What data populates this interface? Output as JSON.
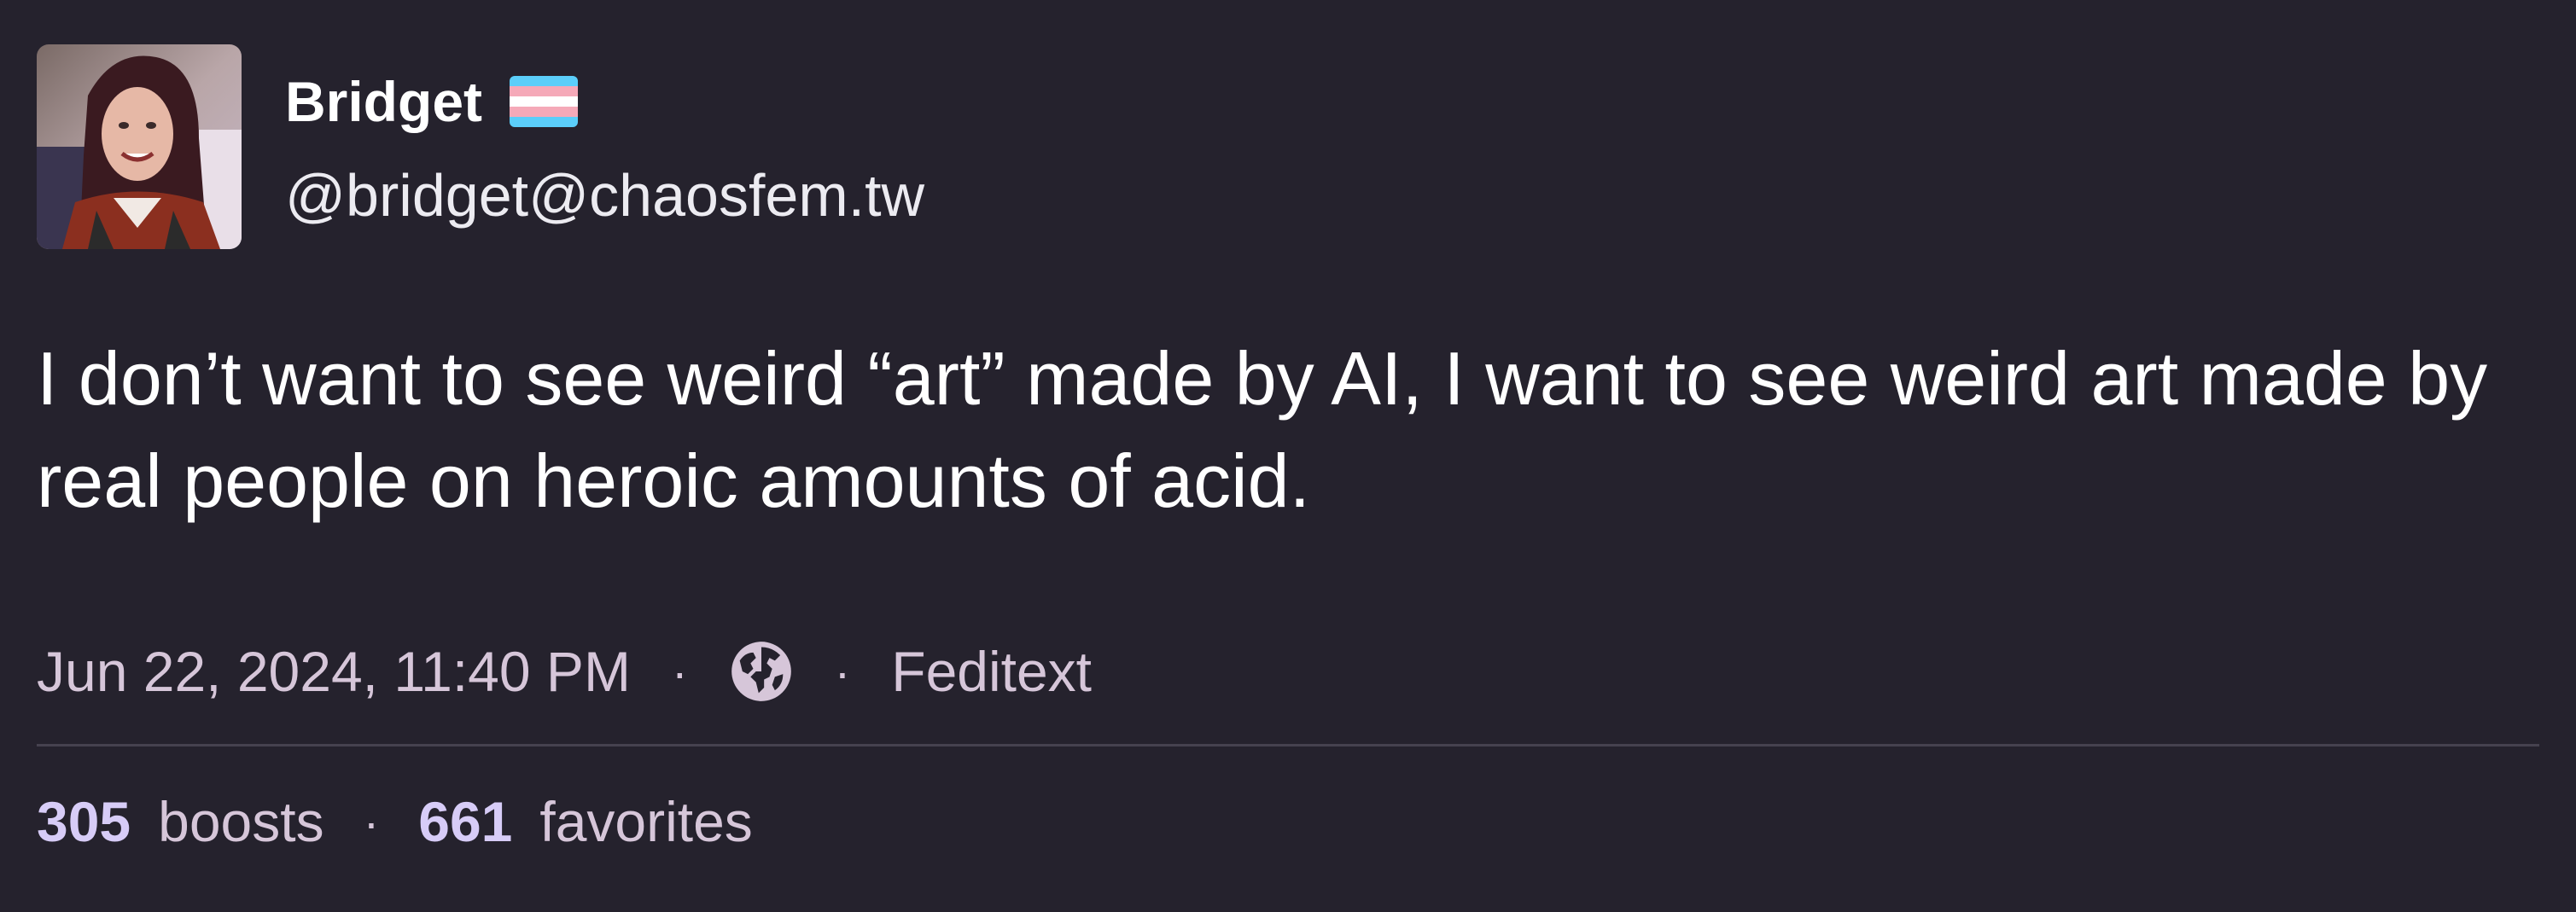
{
  "author": {
    "display_name": "Bridget",
    "handle": "@bridget@chaosfem.tw",
    "flag_icon": "trans-flag-icon",
    "flag_colors": [
      "#5bcefa",
      "#f5a9b8",
      "#ffffff",
      "#f5a9b8",
      "#5bcefa"
    ]
  },
  "post": {
    "text": "I don’t want to see weird “art” made by AI, I want to see weird art made by real people on heroic amounts of acid.",
    "timestamp": "Jun 22, 2024, 11:40 PM",
    "separator": "·",
    "visibility_icon": "globe-icon",
    "application": "Feditext"
  },
  "stats": {
    "boosts_count": "305",
    "boosts_label": "boosts",
    "favorites_count": "661",
    "favorites_label": "favorites",
    "separator": "·"
  },
  "colors": {
    "background": "#25222d",
    "text": "#ffffff",
    "muted_text": "#d6c6d9",
    "count_accent": "#d7ccf7",
    "divider": "#46424f"
  }
}
